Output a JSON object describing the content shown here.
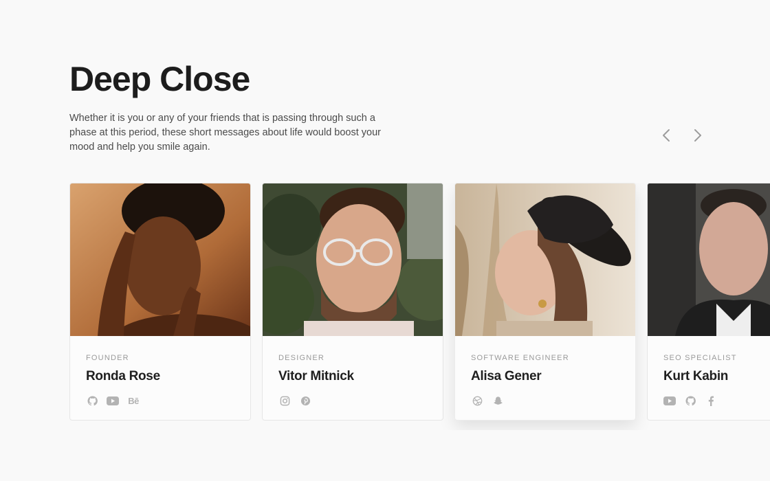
{
  "section": {
    "title": "Deep Close",
    "description": "Whether it is you or any of your friends that is passing through such a phase at this period, these short messages about life would boost your mood and help you smile again."
  },
  "carousel": {
    "prev_icon": "chevron-left-icon",
    "next_icon": "chevron-right-icon"
  },
  "team": [
    {
      "role": "FOUNDER",
      "name": "Ronda Rose",
      "socials": [
        "github-icon",
        "youtube-icon",
        "behance-icon"
      ],
      "behance_text": "Bē"
    },
    {
      "role": "DESIGNER",
      "name": "Vitor Mitnick",
      "socials": [
        "instagram-icon",
        "pinterest-icon"
      ]
    },
    {
      "role": "SOFTWARE ENGINEER",
      "name": "Alisa Gener",
      "socials": [
        "dribbble-icon",
        "snapchat-icon"
      ]
    },
    {
      "role": "SEO SPECIALIST",
      "name": "Kurt Kabin",
      "socials": [
        "youtube-icon",
        "github-icon",
        "facebook-icon"
      ]
    }
  ],
  "colors": {
    "background": "#f9f9f9",
    "heading": "#1d1d1d",
    "muted": "#9a9a9a",
    "icon": "#b3b3b3"
  }
}
